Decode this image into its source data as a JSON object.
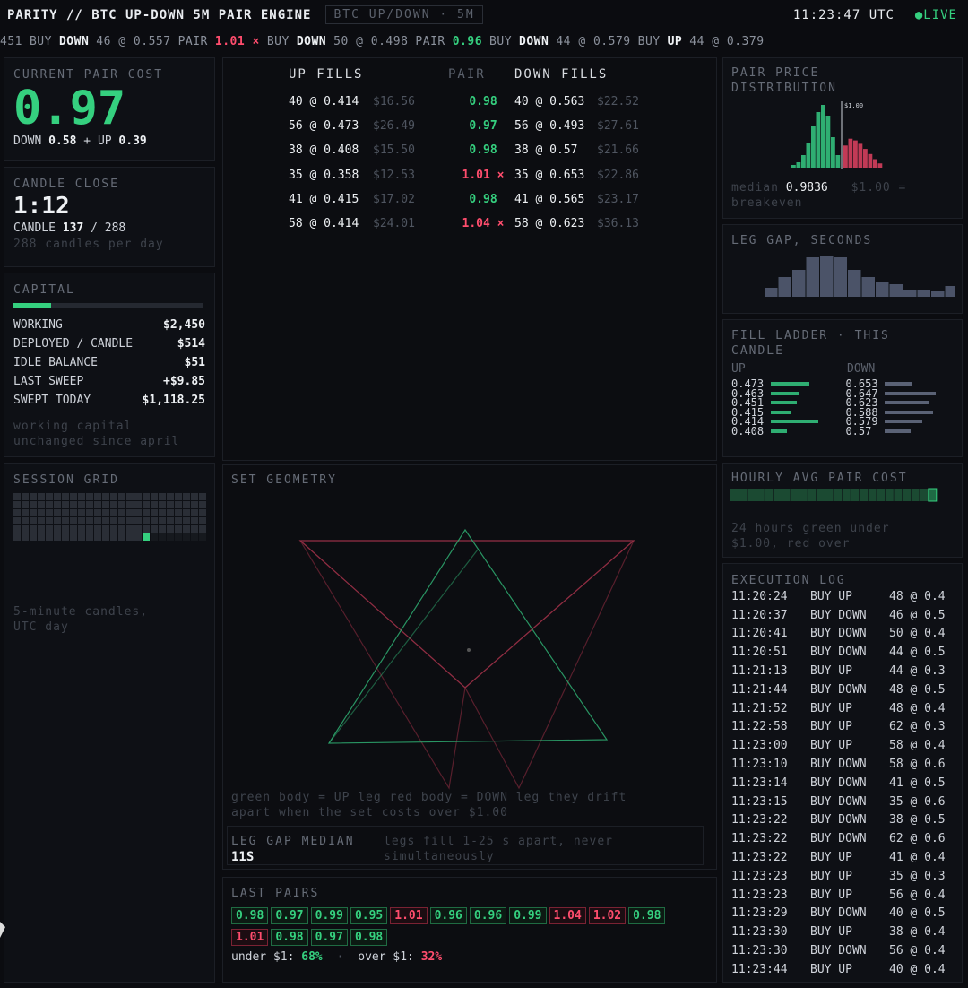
{
  "header": {
    "title": "PARITY // BTC UP-DOWN 5M PAIR ENGINE",
    "market": "BTC UP/DOWN · 5M",
    "clock": "11:23:47 UTC",
    "live": "●LIVE"
  },
  "ticker": [
    {
      "t": "451",
      "c": "n"
    },
    {
      "t": "BUY",
      "c": "n"
    },
    {
      "t": "DOWN",
      "c": "b"
    },
    {
      "t": "46 @ 0.557",
      "c": "n"
    },
    {
      "t": "PAIR",
      "c": "n"
    },
    {
      "t": "1.01 ×",
      "c": "r"
    },
    {
      "t": "BUY",
      "c": "n"
    },
    {
      "t": "DOWN",
      "c": "b"
    },
    {
      "t": "50 @ 0.498",
      "c": "n"
    },
    {
      "t": "PAIR",
      "c": "n"
    },
    {
      "t": "0.96",
      "c": "g"
    },
    {
      "t": "BUY",
      "c": "n"
    },
    {
      "t": "DOWN",
      "c": "b"
    },
    {
      "t": "44 @ 0.579",
      "c": "n"
    },
    {
      "t": "BUY",
      "c": "n"
    },
    {
      "t": "UP",
      "c": "b"
    },
    {
      "t": "44 @ 0.379",
      "c": "n"
    }
  ],
  "pair_cost": {
    "title": "CURRENT PAIR COST",
    "value": "0.97",
    "down_label": "DOWN",
    "down": "0.58",
    "plus": "+",
    "up_label": "UP",
    "up": "0.39"
  },
  "candle": {
    "title": "CANDLE CLOSE",
    "countdown": "1:12",
    "label": "CANDLE",
    "current": "137",
    "sep": "/",
    "total": "288",
    "note": "288 candles per day"
  },
  "capital": {
    "title": "CAPITAL",
    "bar_fraction": 0.2,
    "rows": [
      {
        "k": "WORKING",
        "v": "$2,450"
      },
      {
        "k": "DEPLOYED / CANDLE",
        "v": "$514"
      },
      {
        "k": "IDLE BALANCE",
        "v": "$51"
      },
      {
        "k": "LAST SWEEP",
        "v": "+$9.85"
      },
      {
        "k": "SWEPT TODAY",
        "v": "$1,118.25"
      }
    ],
    "note1": "working capital",
    "note2": "unchanged since april"
  },
  "session": {
    "title": "SESSION GRID",
    "note1": "5-minute candles,",
    "note2": "UTC day"
  },
  "fills": {
    "up_title": "UP FILLS",
    "pair_title": "PAIR",
    "down_title": "DOWN FILLS",
    "rows": [
      {
        "up": "40 @ 0.414",
        "upv": "$16.56",
        "pair": "0.98",
        "ok": true,
        "dn": "40 @ 0.563",
        "dnv": "$22.52"
      },
      {
        "up": "56 @ 0.473",
        "upv": "$26.49",
        "pair": "0.97",
        "ok": true,
        "dn": "56 @ 0.493",
        "dnv": "$27.61"
      },
      {
        "up": "38 @ 0.408",
        "upv": "$15.50",
        "pair": "0.98",
        "ok": true,
        "dn": "38 @ 0.57",
        "dnv": "$21.66"
      },
      {
        "up": "35 @ 0.358",
        "upv": "$12.53",
        "pair": "1.01 ×",
        "ok": false,
        "dn": "35 @ 0.653",
        "dnv": "$22.86"
      },
      {
        "up": "41 @ 0.415",
        "upv": "$17.02",
        "pair": "0.98",
        "ok": true,
        "dn": "41 @ 0.565",
        "dnv": "$23.17"
      },
      {
        "up": "58 @ 0.414",
        "upv": "$24.01",
        "pair": "1.04 ×",
        "ok": false,
        "dn": "58 @ 0.623",
        "dnv": "$36.13"
      }
    ]
  },
  "geometry": {
    "title": "SET GEOMETRY",
    "caption1": "green body = UP leg   red body = DOWN leg   they drift",
    "caption2": "apart when the set costs over $1.00",
    "gap_title": "LEG GAP MEDIAN",
    "gap_value": "11S",
    "gap_note1": "legs fill 1-25 s apart, never",
    "gap_note2": "simultaneously"
  },
  "last_pairs": {
    "title": "LAST PAIRS",
    "items": [
      {
        "v": "0.98",
        "g": true
      },
      {
        "v": "0.97",
        "g": true
      },
      {
        "v": "0.99",
        "g": true
      },
      {
        "v": "0.95",
        "g": true
      },
      {
        "v": "1.01",
        "g": false
      },
      {
        "v": "0.96",
        "g": true
      },
      {
        "v": "0.96",
        "g": true
      },
      {
        "v": "0.99",
        "g": true
      },
      {
        "v": "1.04",
        "g": false
      },
      {
        "v": "1.02",
        "g": false
      },
      {
        "v": "0.98",
        "g": true
      },
      {
        "v": "1.01",
        "g": false
      },
      {
        "v": "0.98",
        "g": true
      },
      {
        "v": "0.97",
        "g": true
      },
      {
        "v": "0.98",
        "g": true
      }
    ],
    "under_label": "under $1:",
    "under": "68%",
    "dot": "·",
    "over_label": "over $1:",
    "over": "32%"
  },
  "distribution": {
    "title1": "PAIR PRICE",
    "title2": "DISTRIBUTION",
    "marker": "$1.00",
    "median_label": "median",
    "median": "0.9836",
    "note1": "$1.00 =",
    "note2": "breakeven",
    "bars_green": [
      3,
      6,
      14,
      28,
      46,
      62,
      70,
      58,
      34,
      14
    ],
    "bars_red": [
      26,
      34,
      32,
      28,
      22,
      16,
      10,
      5
    ]
  },
  "leg_gap": {
    "title": "LEG GAP, SECONDS",
    "bars": [
      10,
      22,
      30,
      44,
      46,
      44,
      30,
      22,
      16,
      14,
      8,
      8,
      6,
      12
    ]
  },
  "ladder": {
    "title1": "FILL LADDER · THIS",
    "title2": "CANDLE",
    "up_label": "UP",
    "down_label": "DOWN",
    "up": [
      {
        "p": "0.473",
        "w": 0.56
      },
      {
        "p": "0.463",
        "w": 0.42
      },
      {
        "p": "0.451",
        "w": 0.38
      },
      {
        "p": "0.415",
        "w": 0.3
      },
      {
        "p": "0.414",
        "w": 0.7
      },
      {
        "p": "0.408",
        "w": 0.24
      }
    ],
    "down": [
      {
        "p": "0.653",
        "w": 0.4
      },
      {
        "p": "0.647",
        "w": 0.75
      },
      {
        "p": "0.623",
        "w": 0.65
      },
      {
        "p": "0.588",
        "w": 0.7
      },
      {
        "p": "0.579",
        "w": 0.55
      },
      {
        "p": "0.57",
        "w": 0.38
      }
    ]
  },
  "hourly": {
    "title": "HOURLY AVG PAIR COST",
    "note1": "24 hours   green under",
    "note2": "$1.00, red over",
    "cells": 24,
    "highlight": 23
  },
  "exec_log": {
    "title": "EXECUTION LOG",
    "rows": [
      {
        "t": "11:20:24",
        "a": "BUY UP",
        "q": "48 @ 0.4"
      },
      {
        "t": "11:20:37",
        "a": "BUY DOWN",
        "q": "46 @ 0.5"
      },
      {
        "t": "11:20:41",
        "a": "BUY DOWN",
        "q": "50 @ 0.4"
      },
      {
        "t": "11:20:51",
        "a": "BUY DOWN",
        "q": "44 @ 0.5"
      },
      {
        "t": "11:21:13",
        "a": "BUY UP",
        "q": "44 @ 0.3"
      },
      {
        "t": "11:21:44",
        "a": "BUY DOWN",
        "q": "48 @ 0.5"
      },
      {
        "t": "11:21:52",
        "a": "BUY UP",
        "q": "48 @ 0.4"
      },
      {
        "t": "11:22:58",
        "a": "BUY UP",
        "q": "62 @ 0.3"
      },
      {
        "t": "11:23:00",
        "a": "BUY UP",
        "q": "58 @ 0.4"
      },
      {
        "t": "11:23:10",
        "a": "BUY DOWN",
        "q": "58 @ 0.6"
      },
      {
        "t": "11:23:14",
        "a": "BUY DOWN",
        "q": "41 @ 0.5"
      },
      {
        "t": "11:23:15",
        "a": "BUY DOWN",
        "q": "35 @ 0.6"
      },
      {
        "t": "11:23:22",
        "a": "BUY DOWN",
        "q": "38 @ 0.5"
      },
      {
        "t": "11:23:22",
        "a": "BUY DOWN",
        "q": "62 @ 0.6"
      },
      {
        "t": "11:23:22",
        "a": "BUY UP",
        "q": "41 @ 0.4"
      },
      {
        "t": "11:23:23",
        "a": "BUY UP",
        "q": "35 @ 0.3"
      },
      {
        "t": "11:23:23",
        "a": "BUY UP",
        "q": "56 @ 0.4"
      },
      {
        "t": "11:23:29",
        "a": "BUY DOWN",
        "q": "40 @ 0.5"
      },
      {
        "t": "11:23:30",
        "a": "BUY UP",
        "q": "38 @ 0.4"
      },
      {
        "t": "11:23:30",
        "a": "BUY DOWN",
        "q": "56 @ 0.4"
      },
      {
        "t": "11:23:44",
        "a": "BUY UP",
        "q": "40 @ 0.4"
      }
    ]
  },
  "colors": {
    "green": "#35d07f",
    "red": "#ff4d6d",
    "bg": "#0b0c10"
  }
}
